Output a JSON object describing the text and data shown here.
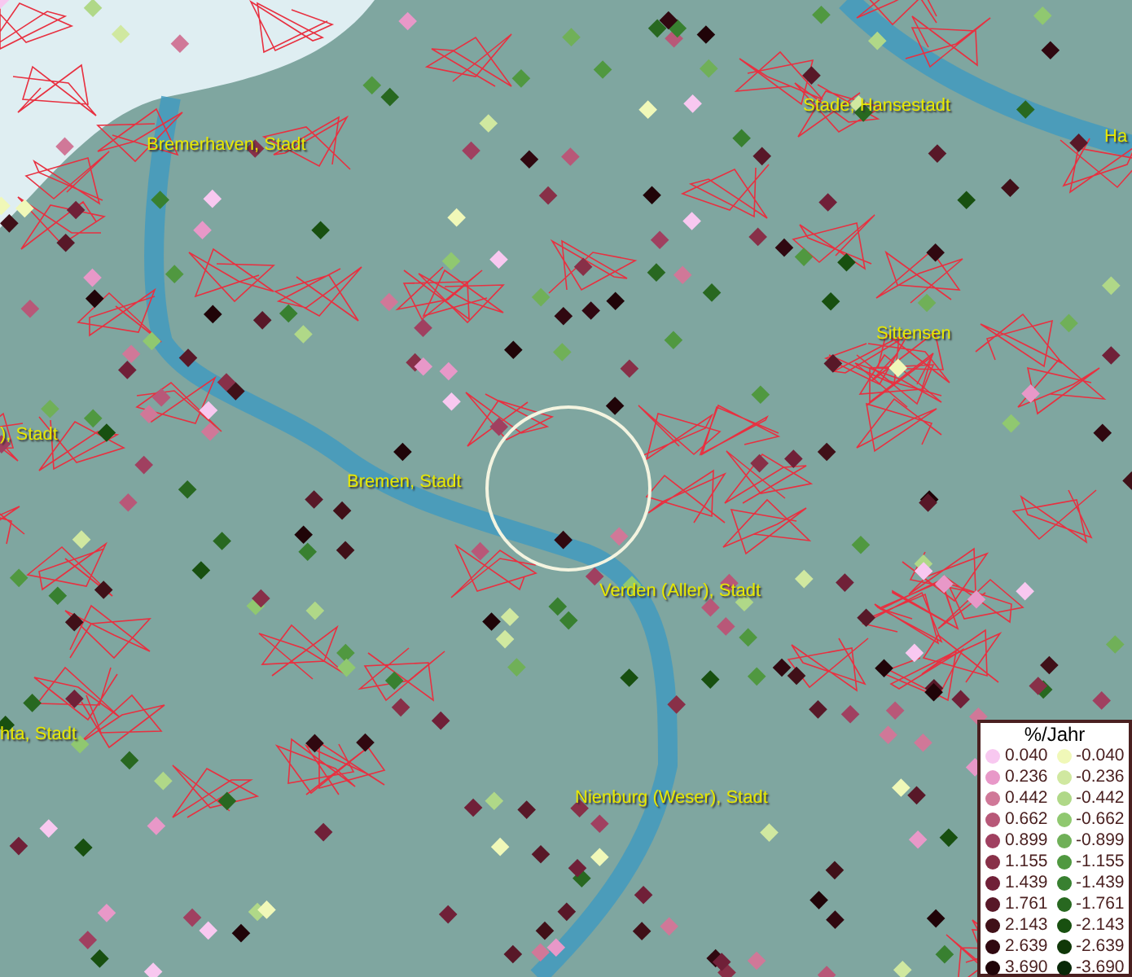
{
  "map": {
    "labels": [
      {
        "text": "Bremerhaven, Stadt"
      },
      {
        "text": "Stade, Hansestadt"
      },
      {
        "text": "Ha"
      },
      {
        "text": "Sittensen"
      },
      {
        "text": "), Stadt"
      },
      {
        "text": "Bremen, Stadt"
      },
      {
        "text": "Verden (Aller), Stadt"
      },
      {
        "text": "hta, Stadt"
      },
      {
        "text": "Nienburg (Weser), Stadt"
      }
    ]
  },
  "legend": {
    "title": "%/Jahr",
    "items": [
      {
        "label": "0.040",
        "color": "#f8c8f0"
      },
      {
        "label": "-0.040",
        "color": "#f0f8b8"
      },
      {
        "label": "0.236",
        "color": "#e898c8"
      },
      {
        "label": "-0.236",
        "color": "#d0e8a0"
      },
      {
        "label": "0.442",
        "color": "#d07898"
      },
      {
        "label": "-0.442",
        "color": "#b0d888"
      },
      {
        "label": "0.662",
        "color": "#b85878"
      },
      {
        "label": "-0.662",
        "color": "#90c870"
      },
      {
        "label": "0.899",
        "color": "#a04060"
      },
      {
        "label": "-0.899",
        "color": "#70b058"
      },
      {
        "label": "1.155",
        "color": "#883048"
      },
      {
        "label": "-1.155",
        "color": "#509840"
      },
      {
        "label": "1.439",
        "color": "#702038"
      },
      {
        "label": "-1.439",
        "color": "#388030"
      },
      {
        "label": "1.761",
        "color": "#581828"
      },
      {
        "label": "-1.761",
        "color": "#286820"
      },
      {
        "label": "2.143",
        "color": "#401018"
      },
      {
        "label": "-2.143",
        "color": "#185010"
      },
      {
        "label": "2.639",
        "color": "#300810"
      },
      {
        "label": "-2.639",
        "color": "#103808"
      },
      {
        "label": "3.690",
        "color": "#200408"
      },
      {
        "label": "-3.690",
        "color": "#082808"
      }
    ]
  }
}
